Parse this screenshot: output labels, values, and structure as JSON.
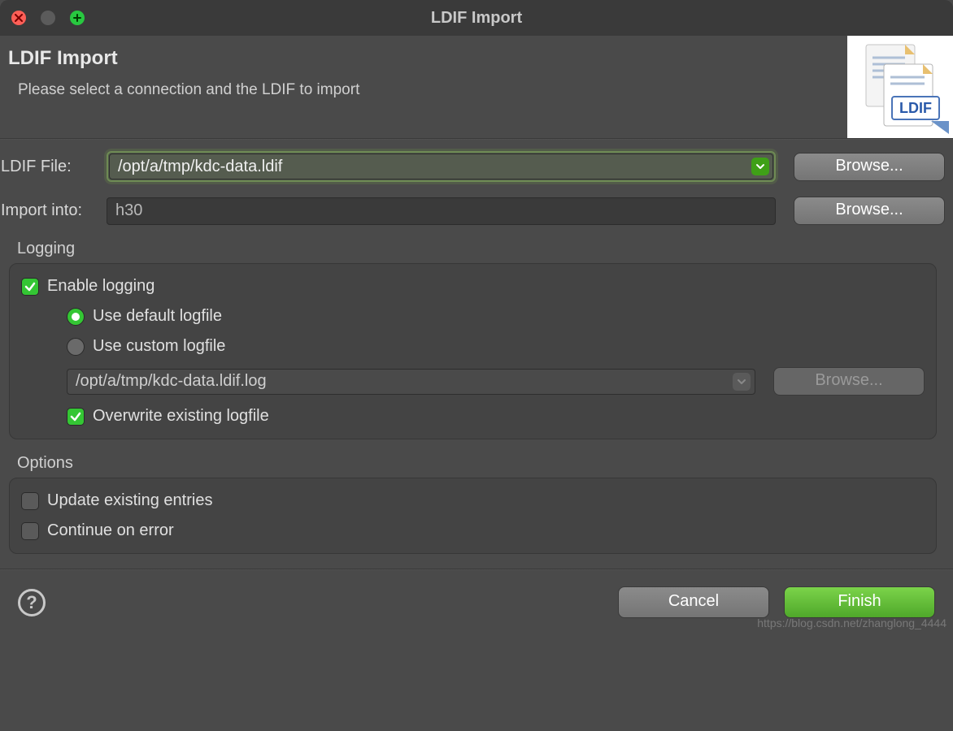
{
  "window": {
    "title": "LDIF Import"
  },
  "header": {
    "title": "LDIF Import",
    "subtitle": "Please select a connection and the LDIF to import",
    "icon_badge": "LDIF"
  },
  "form": {
    "ldif_file_label": "LDIF File:",
    "ldif_file_value": "/opt/a/tmp/kdc-data.ldif",
    "browse_label": "Browse...",
    "import_into_label": "Import into:",
    "import_into_value": "h30"
  },
  "logging": {
    "section_title": "Logging",
    "enable_label": "Enable logging",
    "enable_checked": true,
    "use_default_label": "Use default logfile",
    "use_custom_label": "Use custom logfile",
    "selected_mode": "default",
    "logfile_value": "/opt/a/tmp/kdc-data.ldif.log",
    "browse_label": "Browse...",
    "overwrite_label": "Overwrite existing logfile",
    "overwrite_checked": true
  },
  "options": {
    "section_title": "Options",
    "update_existing_label": "Update existing entries",
    "update_existing_checked": false,
    "continue_on_error_label": "Continue on error",
    "continue_on_error_checked": false
  },
  "footer": {
    "cancel_label": "Cancel",
    "finish_label": "Finish"
  },
  "watermark": "https://blog.csdn.net/zhanglong_4444"
}
